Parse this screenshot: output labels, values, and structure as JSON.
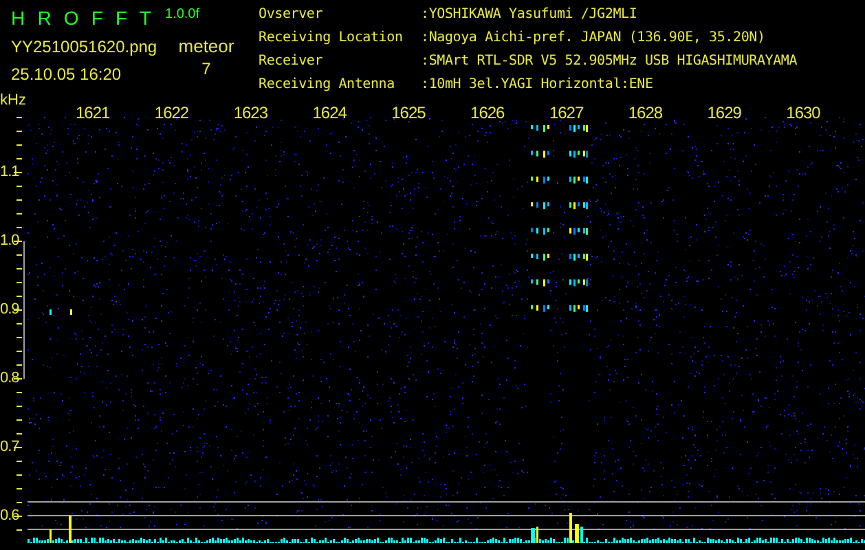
{
  "app": {
    "title": "H R O F F T",
    "version": "1.0.0f",
    "file": "YY2510051620.png",
    "timestamp": "25.10.05 16:20",
    "counter_label": "meteor",
    "counter": "7"
  },
  "station": [
    {
      "label": "Ovserver",
      "value": ":YOSHIKAWA Yasufumi /JG2MLI"
    },
    {
      "label": "Receiving Location",
      "value": ":Nagoya Aichi-pref. JAPAN (136.90E, 35.20N)"
    },
    {
      "label": "Receiver",
      "value": ":SMArt RTL-SDR V5 52.905MHz USB HIGASHIMURAYAMA"
    },
    {
      "label": "Receiving Antenna",
      "value": ":10mH 3el.YAGI Horizontal:ENE"
    }
  ],
  "plot": {
    "unit": "kHz",
    "x_labels": [
      "1621",
      "1622",
      "1623",
      "1624",
      "1625",
      "1626",
      "1627",
      "1628",
      "1629",
      "1630"
    ],
    "y_labels": [
      "1.1",
      "1.0",
      "0.9",
      "0.8",
      "0.7",
      "0.6"
    ]
  }
}
